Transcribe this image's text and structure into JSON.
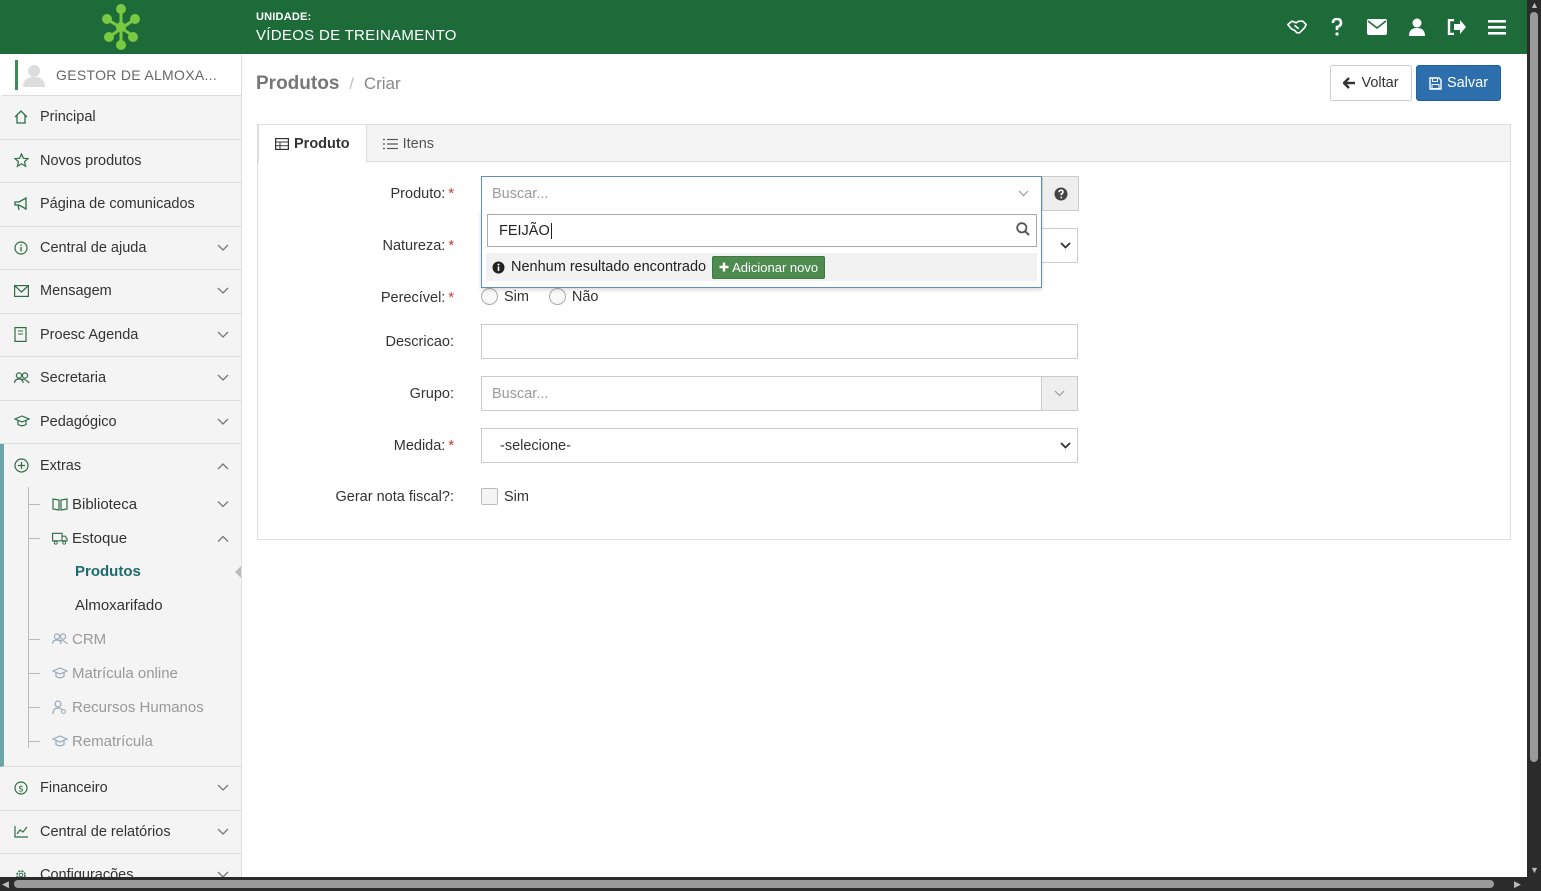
{
  "header": {
    "unit_label": "UNIDADE:",
    "unit_name": "VÍDEOS DE TREINAMENTO",
    "icons": [
      "handshake-icon",
      "question-icon",
      "envelope-icon",
      "user-icon",
      "logout-icon",
      "menu-icon"
    ],
    "bg_color": "#1e6b3a"
  },
  "sidebar": {
    "user_name": "GESTOR DE ALMOXA...",
    "items": [
      {
        "label": "Principal",
        "icon": "home-icon"
      },
      {
        "label": "Novos produtos",
        "icon": "star-icon"
      },
      {
        "label": "Página de comunicados",
        "icon": "megaphone-icon"
      },
      {
        "label": "Central de ajuda",
        "icon": "info-icon"
      },
      {
        "label": "Mensagem",
        "icon": "envelope-icon"
      },
      {
        "label": "Proesc Agenda",
        "icon": "agenda-icon"
      },
      {
        "label": "Secretaria",
        "icon": "users-icon"
      },
      {
        "label": "Pedagógico",
        "icon": "graduation-icon"
      }
    ],
    "extras": {
      "label": "Extras",
      "sub": [
        {
          "label": "Biblioteca",
          "icon": "book-icon"
        },
        {
          "label": "Estoque",
          "icon": "truck-icon"
        }
      ],
      "estoque_sub": [
        "Produtos",
        "Almoxarifado"
      ],
      "dim_sub": [
        {
          "label": "CRM",
          "icon": "users-icon"
        },
        {
          "label": "Matrícula online",
          "icon": "graduation-icon"
        },
        {
          "label": "Recursos Humanos",
          "icon": "person-icon"
        },
        {
          "label": "Rematrícula",
          "icon": "graduation-icon"
        }
      ]
    },
    "bottom_items": [
      {
        "label": "Financeiro",
        "icon": "dollar-icon"
      },
      {
        "label": "Central de relatórios",
        "icon": "chart-icon"
      },
      {
        "label": "Configurações",
        "icon": "gear-icon"
      }
    ]
  },
  "page": {
    "title": "Produtos",
    "subtitle": "Criar",
    "back_label": "Voltar",
    "save_label": "Salvar"
  },
  "tabs": [
    {
      "label": "Produto",
      "icon": "table-icon",
      "active": true
    },
    {
      "label": "Itens",
      "icon": "list-icon",
      "active": false
    }
  ],
  "form": {
    "produto": {
      "label": "Produto:",
      "placeholder": "Buscar..."
    },
    "natureza": {
      "label": "Natureza:"
    },
    "perecivel": {
      "label": "Perecível:",
      "options": [
        "Sim",
        "Não"
      ]
    },
    "descricao": {
      "label": "Descricao:",
      "value": ""
    },
    "grupo": {
      "label": "Grupo:",
      "placeholder": "Buscar..."
    },
    "medida": {
      "label": "Medida:",
      "value": "-selecione-"
    },
    "nota_fiscal": {
      "label": "Gerar nota fiscal?:",
      "option": "Sim"
    }
  },
  "dropdown": {
    "search_value": "FEIJÃO",
    "no_result": "Nenhum resultado encontrado",
    "add_label": "Adicionar novo"
  }
}
